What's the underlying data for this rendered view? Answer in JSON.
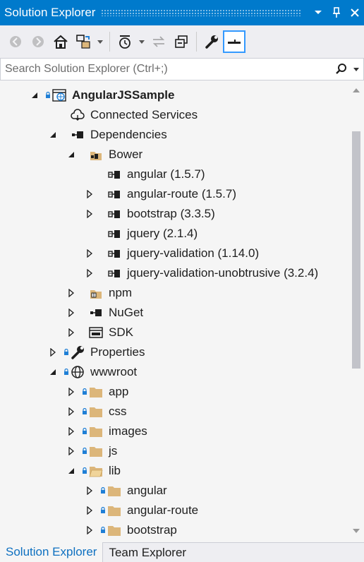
{
  "titlebar": {
    "title": "Solution Explorer",
    "buttons": [
      "chevron-down-icon",
      "pin-icon",
      "close-icon"
    ]
  },
  "toolbar": {
    "icons": [
      "back-icon",
      "forward-icon",
      "home-icon",
      "switch-views-icon",
      "history-icon",
      "sync-icon",
      "collapse-all-icon",
      "properties-wrench-icon",
      "preview-selected-icon"
    ]
  },
  "search": {
    "placeholder": "Search Solution Explorer (Ctrl+;)"
  },
  "tree": {
    "items": [
      {
        "label": "AngularJSSample",
        "bold": true,
        "expand": "open",
        "icon": "web-project-icon",
        "lock": true
      },
      {
        "label": "Connected Services",
        "expand": "none",
        "icon": "cloud-icon",
        "lock": false
      },
      {
        "label": "Dependencies",
        "expand": "open",
        "icon": "dependency-icon",
        "lock": false
      },
      {
        "label": "Bower",
        "expand": "open",
        "icon": "package-folder-icon",
        "lock": false
      },
      {
        "label": "angular (1.5.7)",
        "expand": "none",
        "icon": "package-icon",
        "lock": false
      },
      {
        "label": "angular-route (1.5.7)",
        "expand": "closed",
        "icon": "package-icon",
        "lock": false
      },
      {
        "label": "bootstrap (3.3.5)",
        "expand": "closed",
        "icon": "package-icon",
        "lock": false
      },
      {
        "label": "jquery (2.1.4)",
        "expand": "none",
        "icon": "package-icon",
        "lock": false
      },
      {
        "label": "jquery-validation (1.14.0)",
        "expand": "closed",
        "icon": "package-icon",
        "lock": false
      },
      {
        "label": "jquery-validation-unobtrusive (3.2.4)",
        "expand": "closed",
        "icon": "package-icon",
        "lock": false
      },
      {
        "label": "npm",
        "expand": "closed",
        "icon": "npm-icon",
        "lock": false
      },
      {
        "label": "NuGet",
        "expand": "closed",
        "icon": "dependency-icon",
        "lock": false
      },
      {
        "label": "SDK",
        "expand": "closed",
        "icon": "sdk-icon",
        "lock": false
      },
      {
        "label": "Properties",
        "expand": "closed",
        "icon": "wrench-icon",
        "lock": true
      },
      {
        "label": "wwwroot",
        "expand": "open",
        "icon": "globe-icon",
        "lock": true
      },
      {
        "label": "app",
        "expand": "closed",
        "icon": "folder-icon",
        "lock": true
      },
      {
        "label": "css",
        "expand": "closed",
        "icon": "folder-icon",
        "lock": true
      },
      {
        "label": "images",
        "expand": "closed",
        "icon": "folder-icon",
        "lock": true
      },
      {
        "label": "js",
        "expand": "closed",
        "icon": "folder-icon",
        "lock": true
      },
      {
        "label": "lib",
        "expand": "open",
        "icon": "folder-open-icon",
        "lock": true
      },
      {
        "label": "angular",
        "expand": "closed",
        "icon": "folder-icon",
        "lock": true
      },
      {
        "label": "angular-route",
        "expand": "closed",
        "icon": "folder-icon",
        "lock": true
      },
      {
        "label": "bootstrap",
        "expand": "closed",
        "icon": "folder-icon",
        "lock": true
      }
    ]
  },
  "tabs": [
    {
      "label": "Solution Explorer",
      "active": true
    },
    {
      "label": "Team Explorer",
      "active": false
    }
  ],
  "colors": {
    "accent": "#007acc",
    "folder": "#dcb67a",
    "lock": "#1f7fd6"
  }
}
